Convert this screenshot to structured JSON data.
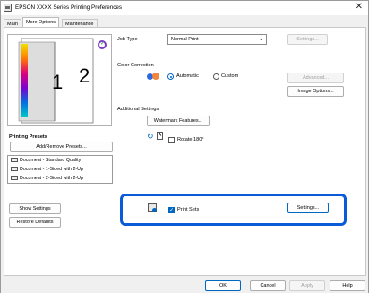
{
  "window": {
    "title": "EPSON XXXX Series Printing Preferences",
    "close_glyph": "✕"
  },
  "tabs": [
    {
      "label": "Main"
    },
    {
      "label": "More Options"
    },
    {
      "label": "Maintenance"
    }
  ],
  "preview": {
    "page_one": "1",
    "page_two": "2"
  },
  "job_type": {
    "label": "Job Type",
    "value": "Normal Print",
    "settings_label": "Settings..."
  },
  "color_correction": {
    "label": "Color Correction",
    "automatic_label": "Automatic",
    "custom_label": "Custom",
    "selected": "Automatic",
    "advanced_label": "Advanced...",
    "image_options_label": "Image Options..."
  },
  "additional_settings": {
    "label": "Additional Settings",
    "watermark_label": "Watermark Features...",
    "rotate_label": "Rotate 180°",
    "rotate_checked": false
  },
  "printing_presets": {
    "label": "Printing Presets",
    "add_remove_label": "Add/Remove Presets...",
    "items": [
      {
        "label": "Document - Standard Quality"
      },
      {
        "label": "Document - 1-Sided with 2-Up"
      },
      {
        "label": "Document - 2-Sided with 2-Up"
      }
    ]
  },
  "left_buttons": {
    "show_settings": "Show Settings",
    "restore_defaults": "Restore Defaults"
  },
  "print_sets": {
    "label": "Print Sets",
    "checked": true,
    "settings_label": "Settings..."
  },
  "footer": {
    "ok": "OK",
    "cancel": "Cancel",
    "apply": "Apply",
    "help": "Help"
  },
  "colors": {
    "accent": "#0067c0",
    "highlight": "#0a5bd8"
  }
}
